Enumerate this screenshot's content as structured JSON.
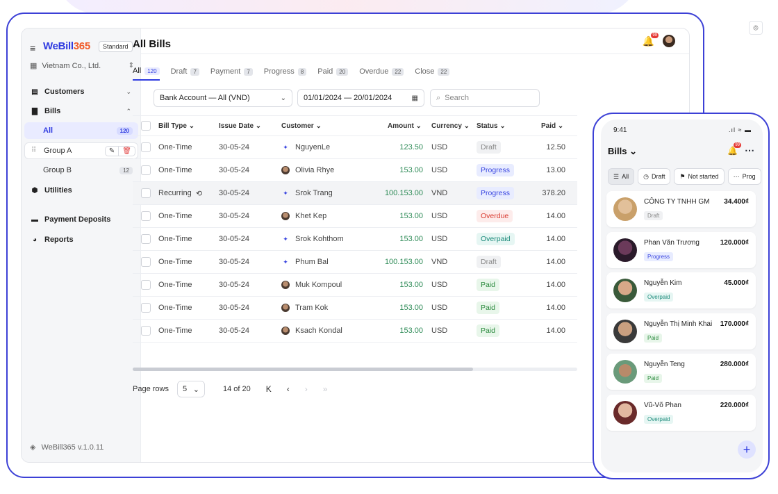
{
  "brand": {
    "logo_a": "WeBill",
    "logo_b": "365",
    "plan": "Standard",
    "company": "Vietnam Co., Ltd.",
    "version": "WeBill365 v.1.0.11"
  },
  "sidebar": {
    "customers": "Customers",
    "bills": "Bills",
    "sub": [
      {
        "label": "All",
        "count": "120"
      },
      {
        "label": "Group A"
      },
      {
        "label": "Group B",
        "count": "12"
      }
    ],
    "utilities": "Utilities",
    "payment_deposits": "Payment Deposits",
    "reports": "Reports"
  },
  "topbar": {
    "notif_count": "99"
  },
  "main": {
    "title": "All Bills",
    "tabs": [
      {
        "label": "All",
        "count": "120"
      },
      {
        "label": "Draft",
        "count": "7"
      },
      {
        "label": "Payment",
        "count": "7"
      },
      {
        "label": "Progress",
        "count": "8"
      },
      {
        "label": "Paid",
        "count": "20"
      },
      {
        "label": "Overdue",
        "count": "22"
      },
      {
        "label": "Close",
        "count": "22"
      }
    ],
    "filters": {
      "account": "Bank Account — All (VND)",
      "dates": "01/01/2024 — 20/01/2024",
      "search_placeholder": "Search"
    },
    "columns": {
      "bill_type": "Bill Type",
      "issue_date": "Issue Date",
      "customer": "Customer",
      "amount": "Amount",
      "currency": "Currency",
      "status": "Status",
      "paid": "Paid"
    },
    "rows": [
      {
        "type": "One-Time",
        "date": "30-05-24",
        "customer": "NguyenLe",
        "amount": "123.50",
        "currency": "USD",
        "status": "Draft",
        "paid": "12.50"
      },
      {
        "type": "One-Time",
        "date": "30-05-24",
        "customer": "Olivia Rhye",
        "amount": "153.00",
        "currency": "USD",
        "status": "Progress",
        "paid": "13.00"
      },
      {
        "type": "Recurring",
        "date": "30-05-24",
        "customer": "Srok Trang",
        "amount": "100.153.00",
        "currency": "VND",
        "status": "Progress",
        "paid": "378.20"
      },
      {
        "type": "One-Time",
        "date": "30-05-24",
        "customer": "Khet Kep",
        "amount": "153.00",
        "currency": "USD",
        "status": "Overdue",
        "paid": "14.00"
      },
      {
        "type": "One-Time",
        "date": "30-05-24",
        "customer": "Srok Kohthom",
        "amount": "153.00",
        "currency": "USD",
        "status": "Overpaid",
        "paid": "14.00"
      },
      {
        "type": "One-Time",
        "date": "30-05-24",
        "customer": "Phum Bal",
        "amount": "100.153.00",
        "currency": "VND",
        "status": "Draft",
        "paid": "14.00"
      },
      {
        "type": "One-Time",
        "date": "30-05-24",
        "customer": "Muk Kompoul",
        "amount": "153.00",
        "currency": "USD",
        "status": "Paid",
        "paid": "14.00"
      },
      {
        "type": "One-Time",
        "date": "30-05-24",
        "customer": "Tram Kok",
        "amount": "153.00",
        "currency": "USD",
        "status": "Paid",
        "paid": "14.00"
      },
      {
        "type": "One-Time",
        "date": "30-05-24",
        "customer": "Ksach Kondal",
        "amount": "153.00",
        "currency": "USD",
        "status": "Paid",
        "paid": "14.00"
      }
    ],
    "pager": {
      "label": "Page rows",
      "size": "5",
      "info": "14 of 20"
    }
  },
  "mobile": {
    "time": "9:41",
    "title": "Bills",
    "notif_count": "99",
    "filters": [
      "All",
      "Draft",
      "Not started",
      "Prog"
    ],
    "cards": [
      {
        "name": "CÔNG TY TNHH GM",
        "amount": "34.400₫",
        "status": "Draft"
      },
      {
        "name": "Phan Văn Trương",
        "amount": "120.000₫",
        "status": "Progress"
      },
      {
        "name": "Nguyễn Kim",
        "amount": "45.000₫",
        "status": "Overpaid"
      },
      {
        "name": "Nguyễn Thị Minh Khai",
        "amount": "170.000₫",
        "status": "Paid"
      },
      {
        "name": "Nguyễn Teng",
        "amount": "280.000₫",
        "status": "Paid"
      },
      {
        "name": "Vũ-Võ Phan",
        "amount": "220.000₫",
        "status": "Overpaid"
      }
    ]
  }
}
